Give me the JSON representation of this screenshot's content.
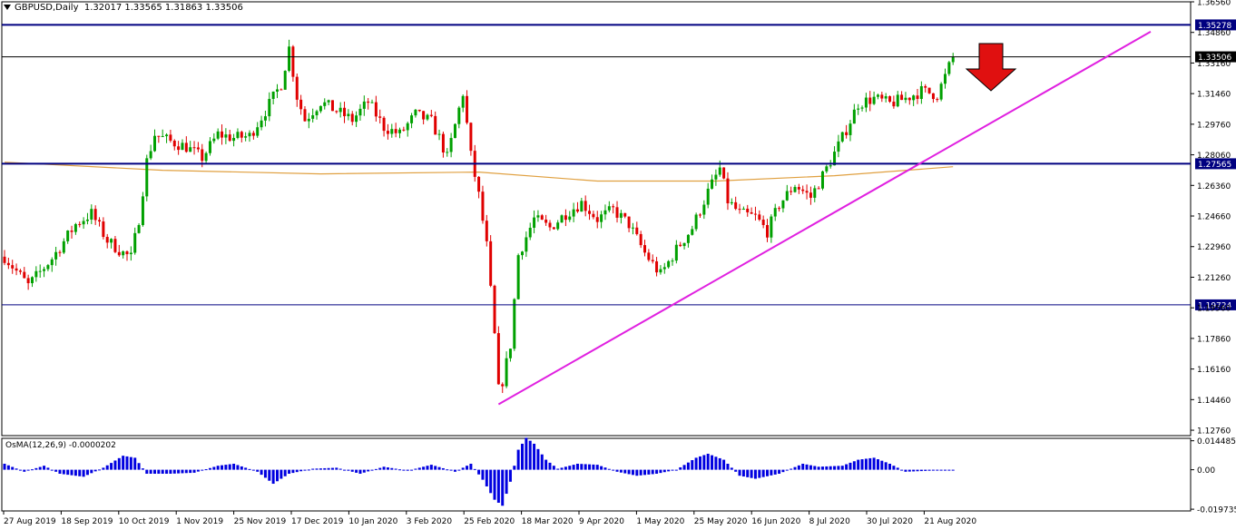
{
  "header": {
    "symbol": "GBPUSD,Daily",
    "ohlc": "1.32017 1.33565 1.31863 1.33506"
  },
  "osma_header": {
    "label": "OsMA(12,26,9) -0.0000202"
  },
  "colors": {
    "bull": "#00a000",
    "bear": "#e00000",
    "hline": "#000080",
    "trendline": "#e020e0",
    "ma": "#e0a040",
    "osma": "#0000e0",
    "arrow": "#e01010"
  },
  "chart_data": [
    {
      "type": "candlestick",
      "symbol": "GBPUSD",
      "timeframe": "Daily",
      "ylim": [
        1.1246,
        1.3656
      ],
      "y_ticks": [
        "1.36560",
        "1.34860",
        "1.33160",
        "1.31460",
        "1.29760",
        "1.28060",
        "1.26360",
        "1.24660",
        "1.22960",
        "1.21260",
        "1.19560",
        "1.17860",
        "1.16160",
        "1.14460",
        "1.12760"
      ],
      "x_tick_labels": [
        "27 Aug 2019",
        "18 Sep 2019",
        "10 Oct 2019",
        "1 Nov 2019",
        "25 Nov 2019",
        "17 Dec 2019",
        "10 Jan 2020",
        "3 Feb 2020",
        "25 Feb 2020",
        "18 Mar 2020",
        "9 Apr 2020",
        "1 May 2020",
        "25 May 2020",
        "16 Jun 2020",
        "8 Jul 2020",
        "30 Jul 2020",
        "21 Aug 2020"
      ],
      "close_path": [
        [
          0,
          1.224
        ],
        [
          6,
          1.208
        ],
        [
          12,
          1.223
        ],
        [
          18,
          1.242
        ],
        [
          22,
          1.248
        ],
        [
          26,
          1.233
        ],
        [
          30,
          1.226
        ],
        [
          32,
          1.2235
        ],
        [
          34,
          1.245
        ],
        [
          36,
          1.277
        ],
        [
          38,
          1.292
        ],
        [
          42,
          1.288
        ],
        [
          46,
          1.285
        ],
        [
          50,
          1.279
        ],
        [
          54,
          1.292
        ],
        [
          58,
          1.29
        ],
        [
          62,
          1.291
        ],
        [
          66,
          1.305
        ],
        [
          70,
          1.32
        ],
        [
          72,
          1.34
        ],
        [
          74,
          1.313
        ],
        [
          76,
          1.3
        ],
        [
          80,
          1.31
        ],
        [
          84,
          1.305
        ],
        [
          88,
          1.3
        ],
        [
          92,
          1.31
        ],
        [
          96,
          1.296
        ],
        [
          100,
          1.292
        ],
        [
          104,
          1.303
        ],
        [
          108,
          1.299
        ],
        [
          110,
          1.29
        ],
        [
          112,
          1.279
        ],
        [
          114,
          1.297
        ],
        [
          116,
          1.315
        ],
        [
          118,
          1.28
        ],
        [
          120,
          1.258
        ],
        [
          122,
          1.23
        ],
        [
          124,
          1.18
        ],
        [
          125,
          1.15
        ],
        [
          126,
          1.155
        ],
        [
          128,
          1.175
        ],
        [
          130,
          1.225
        ],
        [
          134,
          1.245
        ],
        [
          138,
          1.24
        ],
        [
          142,
          1.248
        ],
        [
          146,
          1.254
        ],
        [
          150,
          1.245
        ],
        [
          154,
          1.25
        ],
        [
          158,
          1.242
        ],
        [
          162,
          1.226
        ],
        [
          166,
          1.214
        ],
        [
          170,
          1.228
        ],
        [
          174,
          1.24
        ],
        [
          178,
          1.26
        ],
        [
          181,
          1.273
        ],
        [
          183,
          1.255
        ],
        [
          186,
          1.248
        ],
        [
          190,
          1.246
        ],
        [
          193,
          1.238
        ],
        [
          196,
          1.253
        ],
        [
          200,
          1.264
        ],
        [
          204,
          1.257
        ],
        [
          208,
          1.273
        ],
        [
          212,
          1.29
        ],
        [
          216,
          1.309
        ],
        [
          220,
          1.312
        ],
        [
          224,
          1.309
        ],
        [
          228,
          1.312
        ],
        [
          232,
          1.316
        ],
        [
          236,
          1.314
        ],
        [
          238,
          1.324
        ],
        [
          240,
          1.3351
        ]
      ],
      "horizontal_levels": [
        1.35278,
        1.33506,
        1.27565,
        1.19724
      ],
      "level_labels": [
        "1.35278",
        "1.33506",
        "1.27565",
        "1.19724"
      ],
      "trendline": [
        [
          125,
          1.142
        ],
        [
          290,
          1.349
        ]
      ],
      "moving_average": [
        [
          0,
          1.2765
        ],
        [
          40,
          1.272
        ],
        [
          80,
          1.27
        ],
        [
          120,
          1.271
        ],
        [
          150,
          1.266
        ],
        [
          180,
          1.266
        ],
        [
          210,
          1.269
        ],
        [
          240,
          1.274
        ]
      ],
      "annotation": "down-arrow-at-1.3350"
    },
    {
      "type": "bar",
      "title": "OsMA(12,26,9) -0.0000202",
      "ylim": [
        -0.0206,
        0.0157
      ],
      "y_ticks": [
        "0.0144858",
        "0.00",
        "-0.0197354"
      ],
      "anchors": [
        [
          0,
          0.003
        ],
        [
          5,
          -0.001
        ],
        [
          10,
          0.002
        ],
        [
          14,
          -0.002
        ],
        [
          20,
          -0.0035
        ],
        [
          25,
          0.001
        ],
        [
          30,
          0.007
        ],
        [
          33,
          0.006
        ],
        [
          36,
          -0.002
        ],
        [
          42,
          -0.002
        ],
        [
          48,
          -0.0015
        ],
        [
          54,
          0.002
        ],
        [
          58,
          0.003
        ],
        [
          64,
          -0.001
        ],
        [
          68,
          -0.007
        ],
        [
          72,
          -0.002
        ],
        [
          78,
          0.0005
        ],
        [
          84,
          0.001
        ],
        [
          90,
          -0.002
        ],
        [
          96,
          0.0015
        ],
        [
          102,
          -0.0005
        ],
        [
          108,
          0.0025
        ],
        [
          114,
          -0.001
        ],
        [
          118,
          0.003
        ],
        [
          121,
          -0.005
        ],
        [
          124,
          -0.015
        ],
        [
          126,
          -0.018
        ],
        [
          128,
          -0.006
        ],
        [
          130,
          0.01
        ],
        [
          132,
          0.016
        ],
        [
          134,
          0.013
        ],
        [
          137,
          0.005
        ],
        [
          140,
          0.0005
        ],
        [
          145,
          0.003
        ],
        [
          150,
          0.0025
        ],
        [
          155,
          -0.001
        ],
        [
          160,
          -0.003
        ],
        [
          165,
          -0.002
        ],
        [
          170,
          0.0
        ],
        [
          175,
          0.006
        ],
        [
          178,
          0.008
        ],
        [
          182,
          0.005
        ],
        [
          186,
          -0.003
        ],
        [
          190,
          -0.0045
        ],
        [
          196,
          -0.002
        ],
        [
          202,
          0.003
        ],
        [
          206,
          0.0015
        ],
        [
          212,
          0.002
        ],
        [
          216,
          0.005
        ],
        [
          220,
          0.006
        ],
        [
          224,
          0.003
        ],
        [
          228,
          -0.001
        ],
        [
          234,
          -0.0005
        ],
        [
          240,
          -0.0001
        ]
      ]
    }
  ]
}
